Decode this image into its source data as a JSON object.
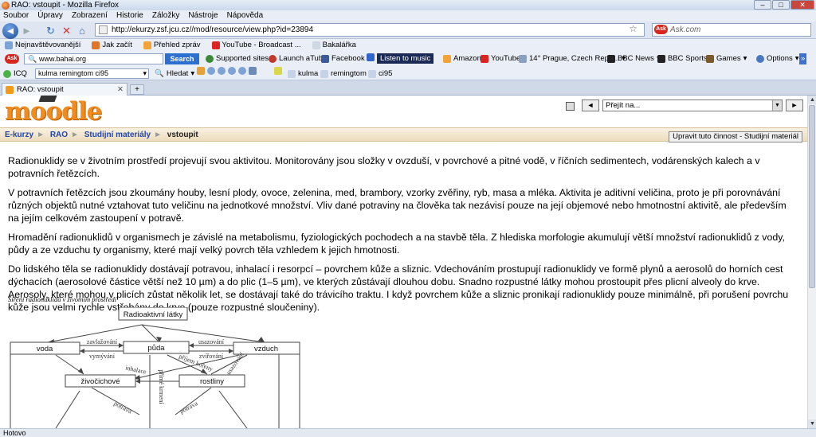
{
  "window": {
    "title": "RAO: vstoupit - Mozilla Firefox"
  },
  "menu": [
    "Soubor",
    "Úpravy",
    "Zobrazení",
    "Historie",
    "Záložky",
    "Nástroje",
    "Nápověda"
  ],
  "nav": {
    "url": "http://ekurzy.zsf.jcu.cz//mod/resource/view.php?id=23894",
    "search_placeholder": "Ask.com"
  },
  "bookmarks": [
    "Nejnavštěvovanější",
    "Jak začít",
    "Přehled zpráv",
    "YouTube - Broadcast ...",
    "Bakalářka"
  ],
  "ask_toolbar": {
    "search_value": "www.bahai.org",
    "search_button": "Search",
    "items": [
      "Supported sites",
      "Launch aTube",
      "Facebook",
      "Listen to music",
      "Amazon",
      "YouTube",
      "14° Prague, Czech Repu...",
      "BBC News",
      "BBC Sports",
      "Games",
      "Options"
    ]
  },
  "icq_toolbar": {
    "label": "ICQ",
    "search_value": "kulma remingtom ci95",
    "find": "Hledat",
    "highlights": [
      "kulma",
      "remingtom",
      "ci95"
    ]
  },
  "tab": {
    "title": "RAO: vstoupit"
  },
  "moodle": {
    "logo": "moodle",
    "jump_label": "Přejít na...",
    "prev": "◄",
    "next": "►",
    "breadcrumb": [
      "E-kurzy",
      "RAO",
      "Studijní materiály",
      "vstoupit"
    ],
    "edit_button": "Upravit tuto činnost - Studijní materiál"
  },
  "article": {
    "paragraphs": [
      "Radionuklidy se v životním prostředí projevují svou aktivitou. Monitorovány jsou složky v ovzduší, v povrchové a pitné vodě, v říčních sedimentech, vodárenských kalech a v potravních řetězcích.",
      "V potravních řetězcích jsou zkoumány houby, lesní plody, ovoce, zelenina, med, brambory, vzorky zvěřiny, ryb, masa a mléka. Aktivita je aditivní veličina, proto je při porovnávání různých objektů nutné vztahovat tuto veličinu na jednotkové množství. Vliv dané potraviny na člověka tak nezávisí pouze na její objemové nebo hmotnostní aktivitě, ale především na jejím celkovém zastoupení v potravě.",
      "Hromadění radionuklidů v organismech je závislé na metabolismu, fyziologických pochodech a na stavbě těla. Z hlediska morfologie akumulují větší množství radionuklidů z vody, půdy a ze vzduchu ty organismy, které mají velký povrch těla vzhledem k jejich hmotnosti.",
      "Do lidského těla se radionuklidy dostávají potravou, inhalací i resorpcí – povrchem kůže a sliznic. Vdechováním prostupují radionuklidy ve formě plynů a aerosolů do horních cest dýchacích (aerosolové částice větší než 10 µm) a do plic (1–5 µm), ve kterých zůstávají dlouhou dobu. Snadno rozpustné látky mohou prostoupit přes plicní alveoly do krve. Aerosoly, které mohou v plicích zůstat několik let, se dostávají také do trávicího traktu. I když povrchem kůže a sliznic pronikají radionuklidy pouze minimálně, při porušení povrchu kůže jsou velmi rychle vstřebány do krve (pouze rozpustné sloučeniny)."
    ],
    "figure_caption": "Šíření radionuklidů v životním prostředí"
  },
  "diagram": {
    "nodes": [
      "Radioaktivní látky",
      "voda",
      "půda",
      "vzduch",
      "živočichové",
      "rostliny"
    ],
    "edges": [
      "zavlažování",
      "vymývání",
      "usazování",
      "zvířování",
      "inhalace",
      "přímé krmení",
      "příjem kořeny",
      "usazování",
      "potrava",
      "potrava"
    ]
  },
  "status": "Hotovo"
}
